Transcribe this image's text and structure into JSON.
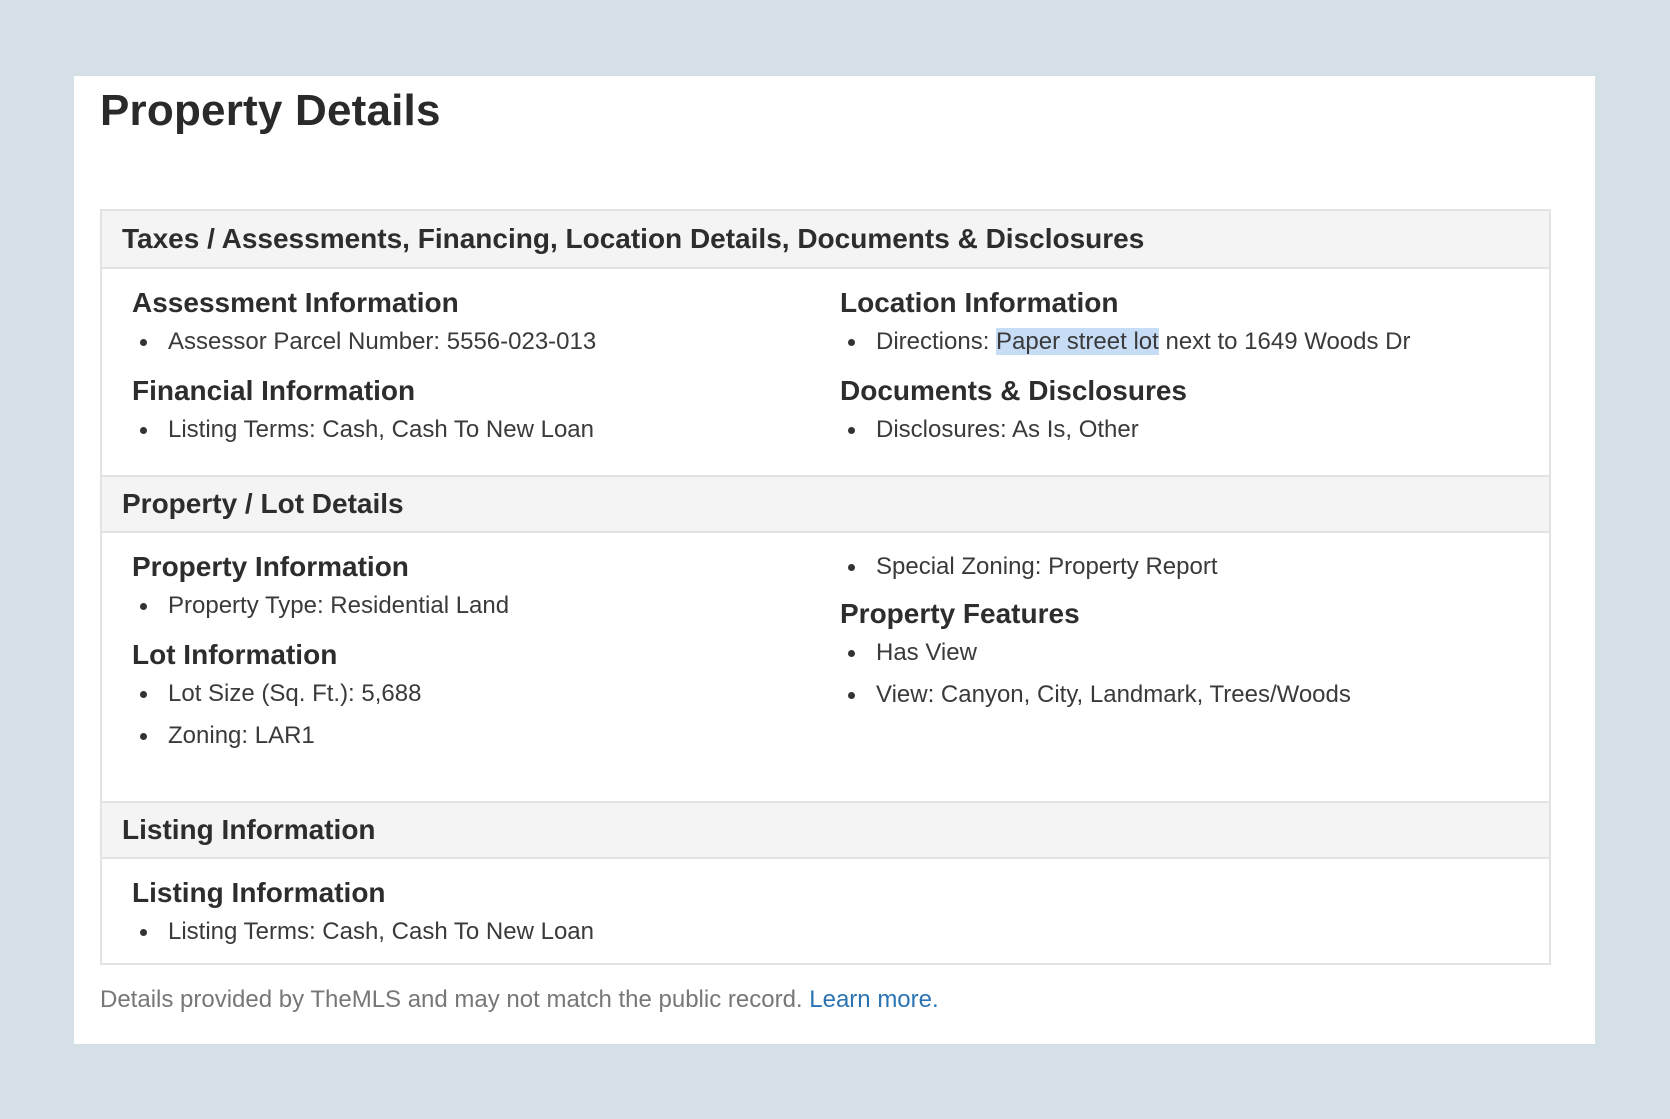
{
  "page": {
    "title": "Property Details"
  },
  "sections": [
    {
      "header": "Taxes / Assessments, Financing, Location Details, Documents & Disclosures",
      "left": [
        {
          "heading": "Assessment Information",
          "items": [
            "Assessor Parcel Number: 5556-023-013"
          ]
        },
        {
          "heading": "Financial Information",
          "items": [
            "Listing Terms: Cash, Cash To New Loan"
          ]
        }
      ],
      "right": [
        {
          "heading": "Location Information",
          "directions_label": "Directions: ",
          "directions_highlight": "Paper street lot",
          "directions_rest": " next to 1649 Woods Dr"
        },
        {
          "heading": "Documents & Disclosures",
          "items": [
            "Disclosures: As Is, Other"
          ]
        }
      ]
    },
    {
      "header": "Property / Lot Details",
      "left": [
        {
          "heading": "Property Information",
          "items": [
            "Property Type: Residential Land"
          ]
        },
        {
          "heading": "Lot Information",
          "items": [
            "Lot Size (Sq. Ft.): 5,688",
            "Zoning: LAR1"
          ]
        }
      ],
      "right": [
        {
          "heading": "",
          "items": [
            "Special Zoning: Property Report"
          ]
        },
        {
          "heading": "Property Features",
          "items": [
            "Has View",
            "View: Canyon, City, Landmark, Trees/Woods"
          ]
        }
      ]
    },
    {
      "header": "Listing Information",
      "left": [
        {
          "heading": "Listing Information",
          "items": [
            "Listing Terms: Cash, Cash To New Loan"
          ]
        }
      ]
    }
  ],
  "footer": {
    "note": "Details provided by TheMLS and may not match the public record.",
    "link": "Learn more."
  },
  "colors": {
    "page_background": "#d5e0e6",
    "card_background": "#ffffff",
    "section_header_background": "#f4f4f4",
    "text_highlight": "#c7dcf5",
    "link": "#2b74b4"
  }
}
